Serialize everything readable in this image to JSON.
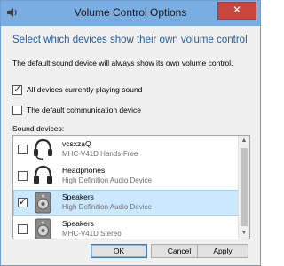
{
  "window": {
    "title": "Volume Control Options",
    "close_glyph": "✕",
    "accent_color": "#1f5fa8",
    "titlebar_color": "#7aaee3"
  },
  "main": {
    "heading": "Select which devices show their own volume control",
    "description": "The default sound device will always show its own volume control."
  },
  "options": [
    {
      "label": "All devices currently playing sound",
      "checked": true
    },
    {
      "label": "The default communication device",
      "checked": false
    }
  ],
  "devices_label": "Sound devices:",
  "devices": [
    {
      "name": "vcsxzaQ",
      "description": "MHC-V41D Hands-Free",
      "checked": false,
      "selected": false,
      "icon": "headset-icon"
    },
    {
      "name": "Headphones",
      "description": "High Definition Audio Device",
      "checked": false,
      "selected": false,
      "icon": "headphones-icon"
    },
    {
      "name": "Speakers",
      "description": "High Definition Audio Device",
      "checked": true,
      "selected": true,
      "icon": "speaker-icon"
    },
    {
      "name": "Speakers",
      "description": "MHC-V41D Stereo",
      "checked": false,
      "selected": false,
      "icon": "speaker-icon"
    }
  ],
  "buttons": {
    "ok": "OK",
    "cancel": "Cancel",
    "apply": "Apply"
  }
}
